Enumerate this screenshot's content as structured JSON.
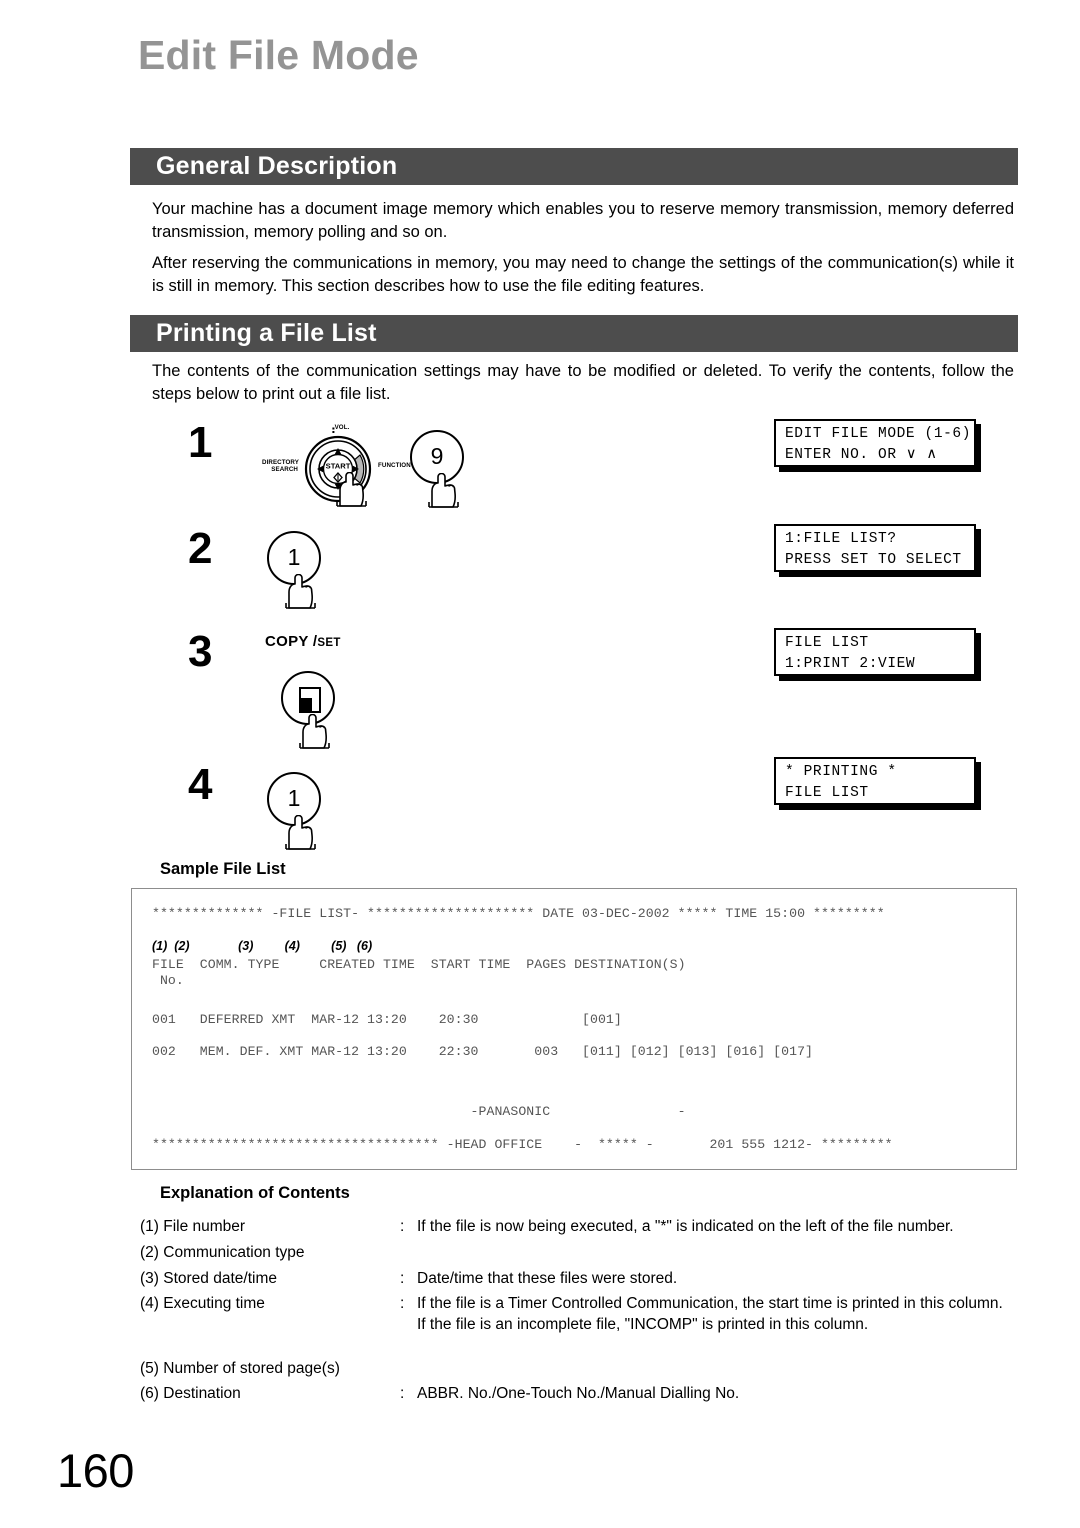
{
  "page": {
    "title": "Edit File Mode",
    "number": "160"
  },
  "sections": [
    {
      "heading": "General Description"
    },
    {
      "heading": "Printing a File List"
    }
  ],
  "paragraphs": {
    "general_1": "Your machine has a document image memory which enables you to reserve memory transmission, memory deferred transmission, memory polling and so on.",
    "general_2": "After reserving the communications in memory, you may need to change the settings of the communication(s) while it is still in memory.  This section describes how to use the file editing features.",
    "printing_1": "The contents of the communication settings may have to be modified or deleted.  To verify the contents, follow the steps below to print out a file list."
  },
  "steps": [
    {
      "number": "1",
      "key_label": "9",
      "wheel": {
        "center": "START",
        "top": "VOL.",
        "left": "DIRECTORY\nSEARCH",
        "right": "FUNCTION"
      },
      "lcd": {
        "line1": "EDIT FILE MODE (1-6)",
        "line2": "ENTER NO. OR ∨ ∧"
      }
    },
    {
      "number": "2",
      "key_label": "1",
      "lcd": {
        "line1": "1:FILE LIST?",
        "line2": "PRESS SET TO SELECT"
      }
    },
    {
      "number": "3",
      "key_label": "COPY / SET",
      "key_label_main": "COPY /",
      "key_label_small": "SET",
      "lcd": {
        "line1": "FILE LIST",
        "line2": "1:PRINT 2:VIEW"
      }
    },
    {
      "number": "4",
      "key_label": "1",
      "lcd": {
        "line1": "* PRINTING *",
        "line2": "FILE LIST"
      }
    }
  ],
  "sample_file_list": {
    "heading": "Sample File List",
    "header_line": "************** -FILE LIST- ********************* DATE 03-DEC-2002 ***** TIME 15:00 *********",
    "marker_line": "(1)  (2)              (3)         (4)         (5)   (6)",
    "column_line": "FILE  COMM. TYPE     CREATED TIME  START TIME  PAGES DESTINATION(S)",
    "column_line_sub": " No.",
    "rows": [
      "001   DEFERRED XMT  MAR-12 13:20    20:30             [001]",
      "002   MEM. DEF. XMT MAR-12 13:20    22:30       003   [011] [012] [013] [016] [017]"
    ],
    "panasonic_line": "                                        -PANASONIC                -",
    "footer_line": "************************************ -HEAD OFFICE    -  ***** -       201 555 1212- *********"
  },
  "explanation": {
    "heading": "Explanation of Contents",
    "items": [
      {
        "label": "(1) File number",
        "colon": ":",
        "desc": "If the file is now being executed, a \"*\" is indicated on the left of the file number.",
        "desc2": ""
      },
      {
        "label": "(2) Communication type",
        "colon": "",
        "desc": "",
        "desc2": ""
      },
      {
        "label": "(3) Stored date/time",
        "colon": ":",
        "desc": "Date/time that these files were stored.",
        "desc2": ""
      },
      {
        "label": "(4) Executing time",
        "colon": ":",
        "desc": "If the file is a Timer Controlled Communication, the start time is printed in this column.",
        "desc2": "If the file is an incomplete file, \"INCOMP\" is printed in this column."
      },
      {
        "label": "(5) Number of stored page(s)",
        "colon": "",
        "desc": "",
        "desc2": ""
      },
      {
        "label": "(6) Destination",
        "colon": ":",
        "desc": "ABBR. No./One-Touch No./Manual Dialling No.",
        "desc2": ""
      }
    ]
  },
  "colors": {
    "title_gray": "#949494",
    "bar_gray": "#4d4d4d",
    "filelist_text": "#555555",
    "box_border": "#8d8d8d"
  }
}
